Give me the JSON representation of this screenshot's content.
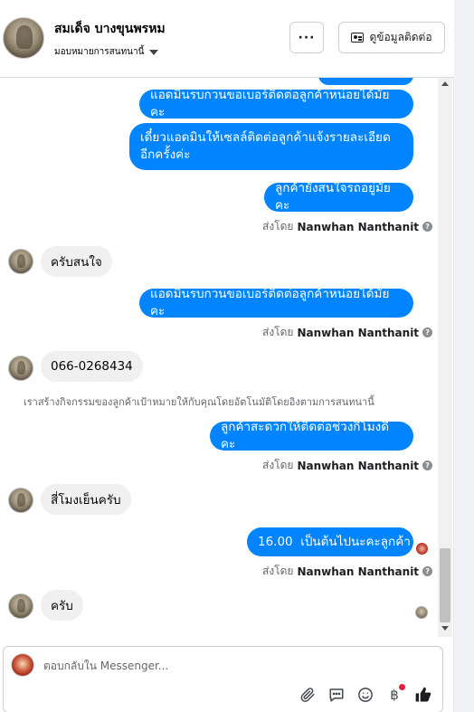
{
  "header": {
    "contact_name": "สมเด็จ บางขุนพรหม",
    "assign_label": "มอบหมายการสนทนานี้",
    "more_label": "···",
    "contact_info_label": "ดูข้อมูลติดต่อ"
  },
  "messages": {
    "out_1": "แอดมินรบกวนขอเบอร์ติดต่อลูกค้าหน่อยได้มั้ยคะ",
    "out_2": "เดี๋ยวแอดมินให้เซลล์ติดต่อลูกค้าแจ้งรายละเอียดอีกครั้งค่ะ",
    "out_3": "ลูกค้ายังสนใจรถอยู่มั้ยคะ",
    "in_1": "ครับสนใจ",
    "out_4": "แอดมินรบกวนขอเบอร์ติดต่อลูกค้าหน่อยได้มั้ยคะ",
    "in_2": "066-0268434",
    "system_note": "เราสร้างกิจกรรมของลูกค้าเป้าหมายให้กับคุณโดยอัตโนมัติโดยอิงตามการสนทนานี้",
    "out_5": "ลูกค้าสะดวกให้ติดต่อช่วงกี่โมงดีคะ",
    "in_3": "สี่โมงเย็นครับ",
    "out_6": "16.00  เป็นต้นไปนะคะลูกค้า",
    "in_4": "ครับ"
  },
  "sent_by": {
    "prefix": "ส่งโดย",
    "name": "Nanwhan Nanthanit"
  },
  "composer": {
    "placeholder": "ตอบกลับใน Messenger..."
  },
  "icons": {
    "attach": "paperclip-icon",
    "saved_replies": "chat-bubble-icon",
    "emoji": "smiley-icon",
    "payment": "baht-icon",
    "like": "thumbs-up-icon"
  },
  "colors": {
    "outgoing_bubble": "#0084ff",
    "incoming_bubble": "#f0f0f0",
    "notification_dot": "#e41e3f"
  }
}
